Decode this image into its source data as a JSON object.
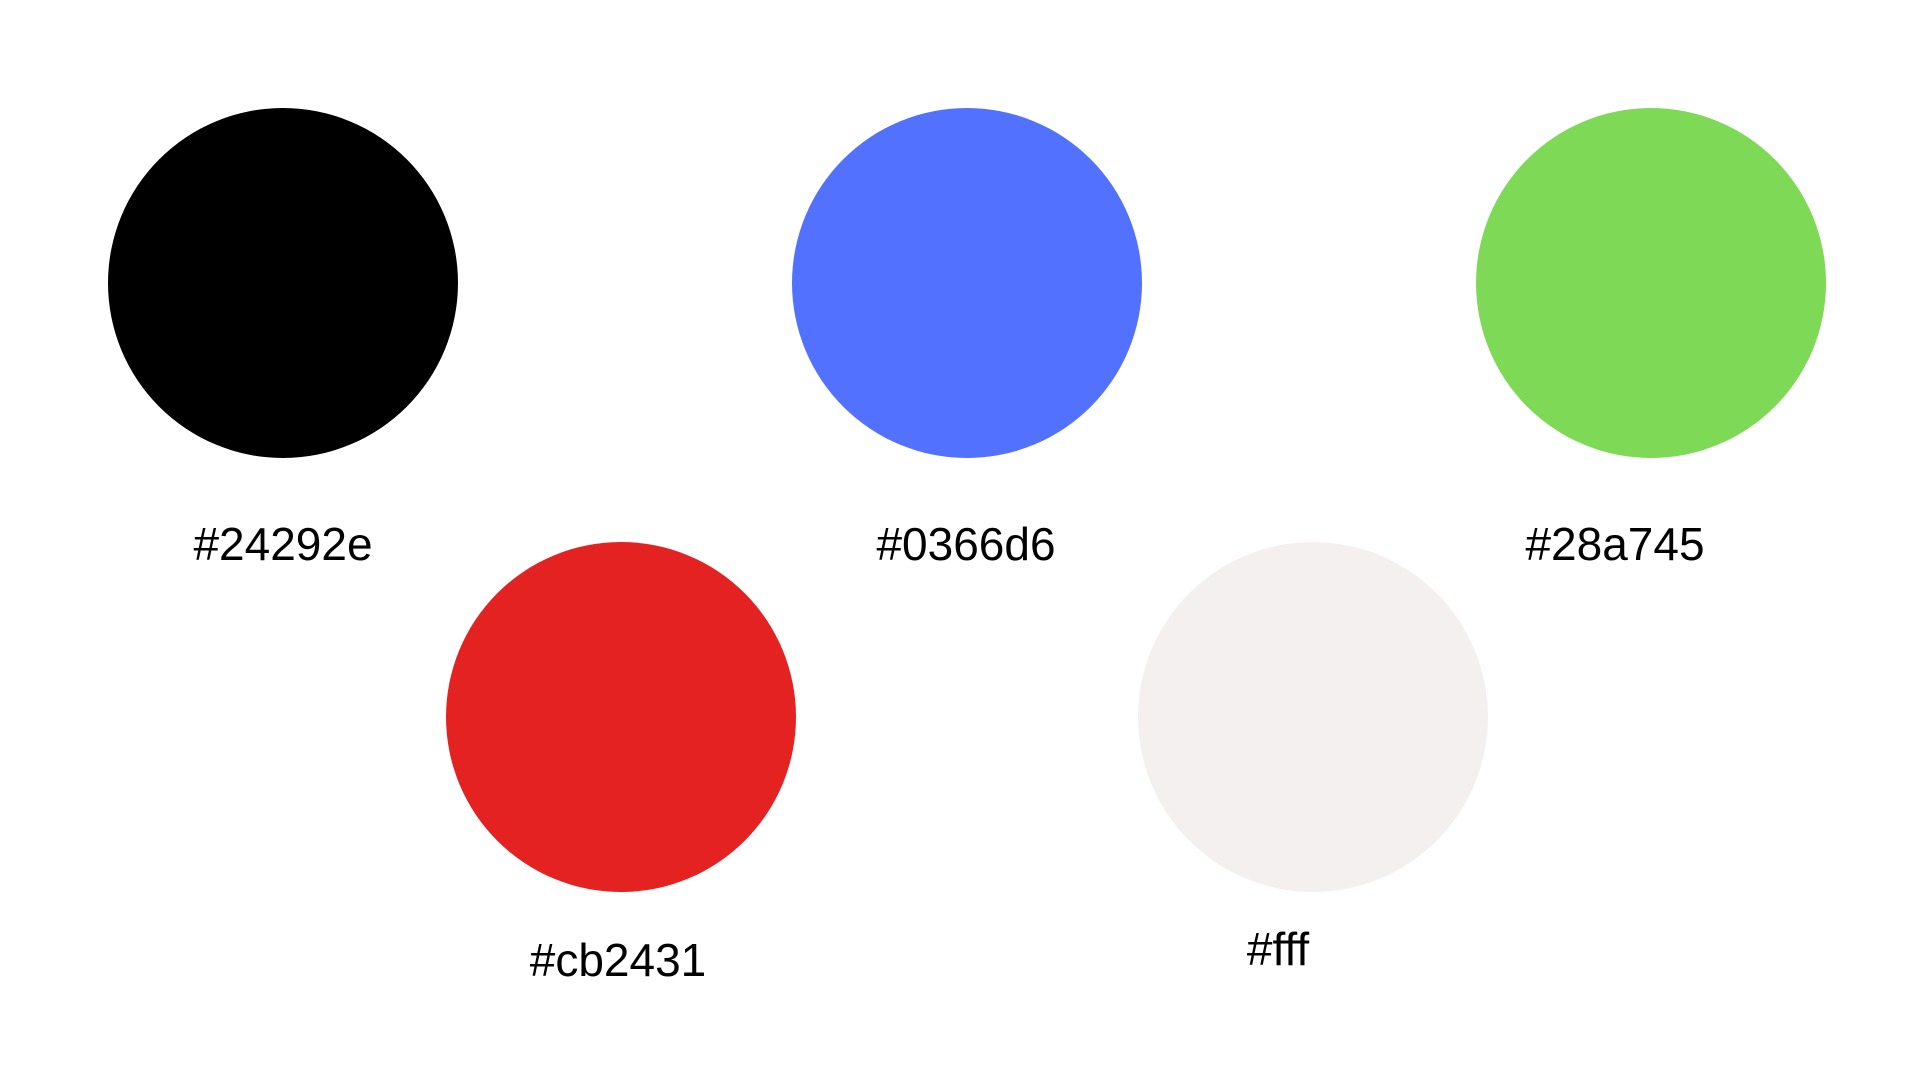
{
  "swatches": [
    {
      "label": "#24292e",
      "fill": "#000000"
    },
    {
      "label": "#0366d6",
      "fill": "#5271ff"
    },
    {
      "label": "#28a745",
      "fill": "#7ed957"
    },
    {
      "label": "#cb2431",
      "fill": "#e52222"
    },
    {
      "label": "#fff",
      "fill": "#f5f0f0"
    }
  ]
}
